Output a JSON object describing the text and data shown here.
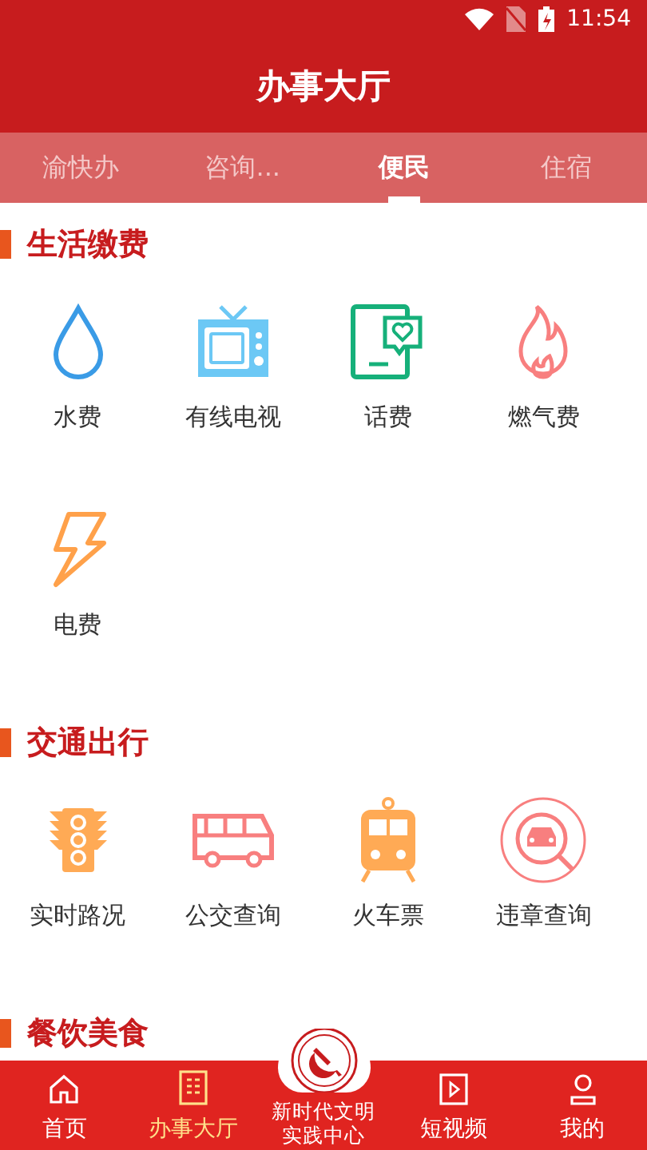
{
  "status_bar": {
    "time": "11:54"
  },
  "header": {
    "title": "办事大厅"
  },
  "tabs": [
    {
      "label": "渝快办",
      "selected": false
    },
    {
      "label": "咨询...",
      "selected": false
    },
    {
      "label": "便民",
      "selected": true
    },
    {
      "label": "住宿",
      "selected": false
    }
  ],
  "sections": [
    {
      "title": "生活缴费",
      "items": [
        {
          "label": "水费",
          "kind": "water"
        },
        {
          "label": "有线电视",
          "kind": "tv"
        },
        {
          "label": "话费",
          "kind": "phone"
        },
        {
          "label": "燃气费",
          "kind": "gas"
        },
        {
          "label": "电费",
          "kind": "power"
        }
      ]
    },
    {
      "title": "交通出行",
      "items": [
        {
          "label": "实时路况",
          "kind": "traffic"
        },
        {
          "label": "公交查询",
          "kind": "bus"
        },
        {
          "label": "火车票",
          "kind": "train"
        },
        {
          "label": "违章查询",
          "kind": "violation"
        }
      ]
    },
    {
      "title": "餐饮美食"
    }
  ],
  "bottom_nav": [
    {
      "label": "首页",
      "kind": "home",
      "selected": false
    },
    {
      "label": "办事大厅",
      "kind": "hall",
      "selected": true
    },
    {
      "label": "新时代文明实践中心",
      "kind": "center",
      "selected": false
    },
    {
      "label": "短视频",
      "kind": "video",
      "selected": false
    },
    {
      "label": "我的",
      "kind": "me",
      "selected": false
    }
  ]
}
